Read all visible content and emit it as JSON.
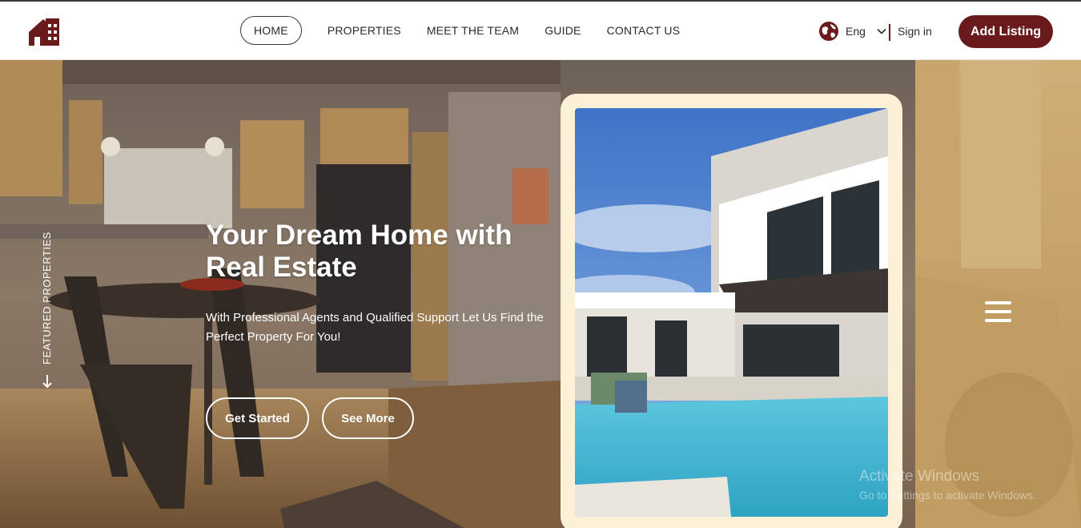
{
  "header": {
    "nav": [
      {
        "label": "HOME",
        "active": true
      },
      {
        "label": "PROPERTIES",
        "active": false
      },
      {
        "label": "MEET THE TEAM",
        "active": false
      },
      {
        "label": "GUIDE",
        "active": false
      },
      {
        "label": "CONTACT US",
        "active": false
      }
    ],
    "language": "Eng",
    "sign_in": "Sign in",
    "add_listing": "Add Listing"
  },
  "hero": {
    "side_label": "FEATURED PROPERTIES",
    "headline": "Your Dream Home with Real Estate",
    "subheadline": "With Professional Agents and Qualified Support Let Us Find the Perfect Property For You!",
    "buttons": {
      "get_started": "Get Started",
      "see_more": "See More"
    }
  },
  "watermark": {
    "title": "Activate Windows",
    "subtitle": "Go to Settings to activate Windows."
  },
  "colors": {
    "brand": "#6b1a1c",
    "card_background": "#fbf1d7",
    "right_panel_tint": "#c9a56a"
  },
  "icons": {
    "logo": "house-logo-icon",
    "language": "globe-icon",
    "dropdown": "chevron-down-icon",
    "featured": "arrow-down-icon",
    "menu": "hamburger-menu-icon"
  }
}
